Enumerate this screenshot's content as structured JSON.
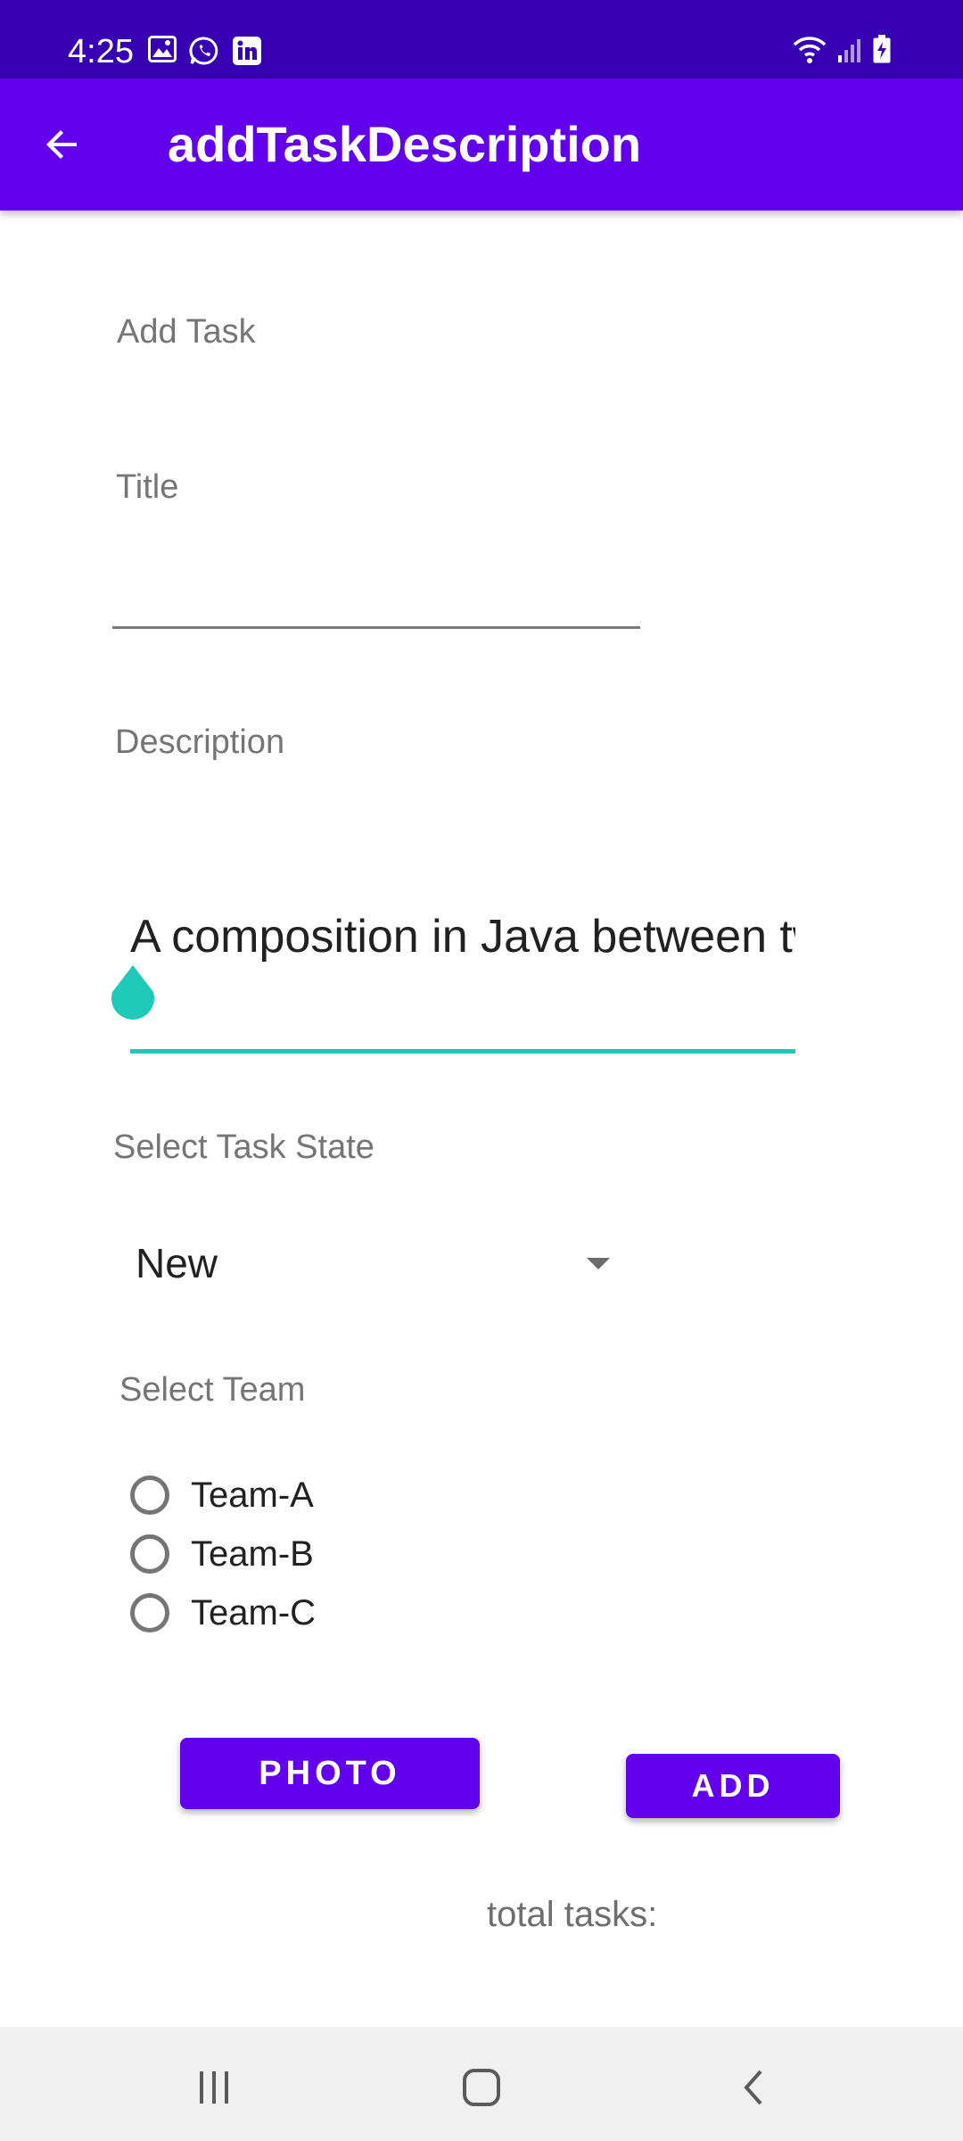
{
  "status_bar": {
    "time": "4:25",
    "left_icons": [
      "image-icon",
      "whatsapp-icon",
      "linkedin-icon"
    ],
    "right_icons": [
      "wifi-icon",
      "signal-icon",
      "battery-charging-icon"
    ]
  },
  "app_bar": {
    "title": "addTaskDescription",
    "back_icon": "arrow-back-icon"
  },
  "form": {
    "heading": "Add Task",
    "title_label": "Title",
    "title_value": "",
    "description_label": "Description",
    "description_value": "A composition in Java between two classes",
    "state_label": "Select Task State",
    "state_selected": "New",
    "team_label": "Select Team",
    "teams": [
      {
        "label": "Team-A",
        "selected": false
      },
      {
        "label": "Team-B",
        "selected": false
      },
      {
        "label": "Team-C",
        "selected": false
      }
    ]
  },
  "buttons": {
    "photo": "PHOTO",
    "add": "ADD"
  },
  "footer": {
    "total_tasks_label": "total tasks:"
  },
  "nav_bar": {
    "recents": "recents-icon",
    "home": "home-icon",
    "back": "back-icon"
  },
  "colors": {
    "status_bar": "#3700b3",
    "primary": "#6200ee",
    "accent": "#1ec9b8",
    "nav_bar": "#f0f0f0"
  }
}
